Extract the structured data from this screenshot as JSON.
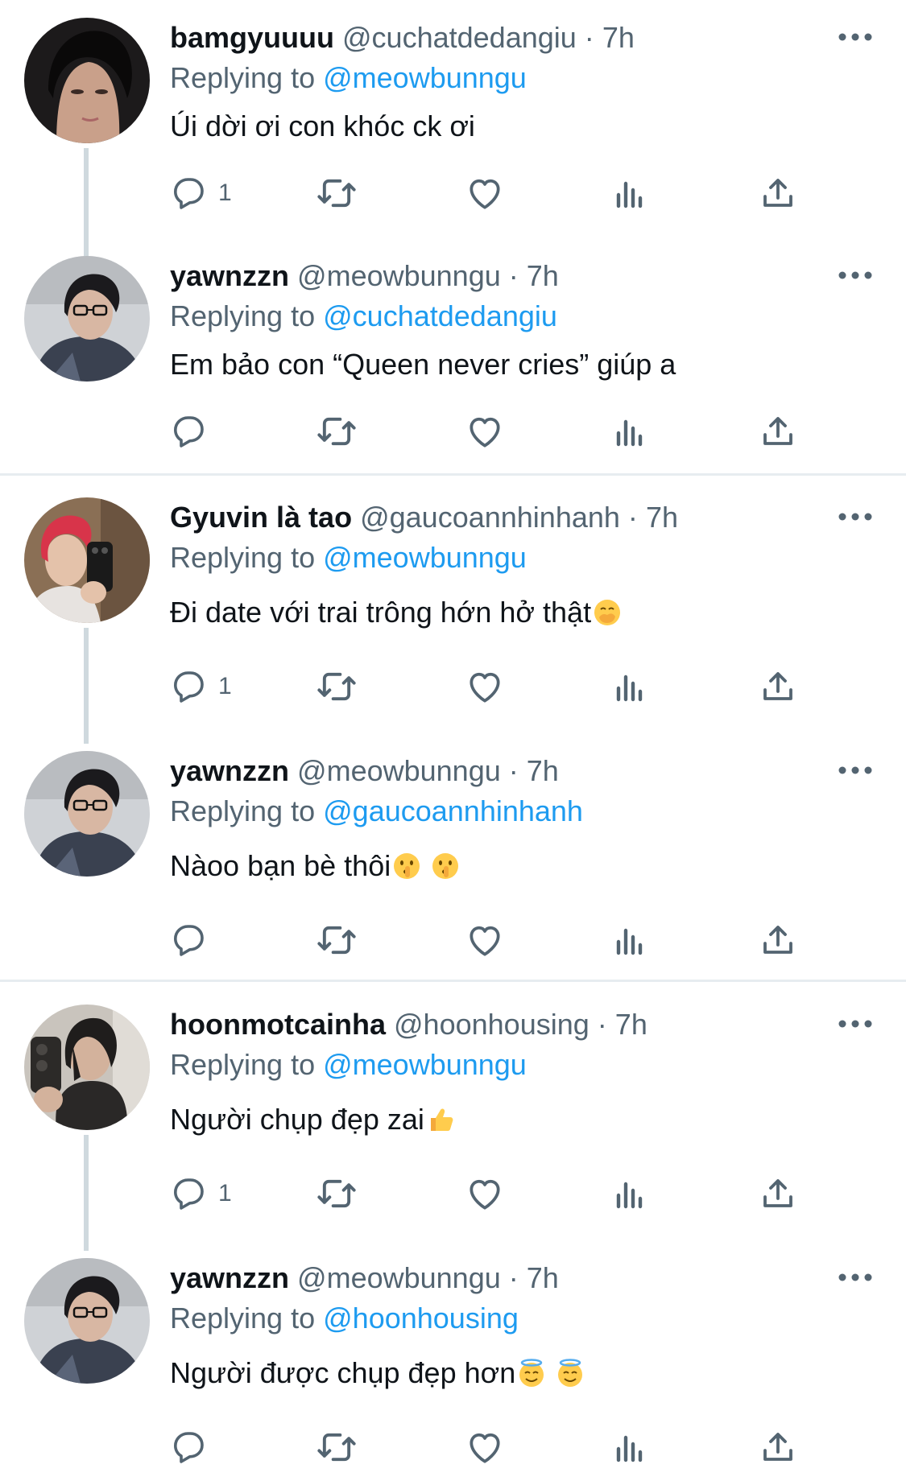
{
  "colors": {
    "accent": "#1d9bf0",
    "secondary_text": "#536471",
    "primary_text": "#0f1419",
    "divider": "#e7ecf0",
    "thread_line": "#cfd9de"
  },
  "icons": [
    "reply-icon",
    "retweet-icon",
    "like-icon",
    "views-icon",
    "share-icon",
    "more-icon"
  ],
  "tweets": [
    {
      "name": "bamgyuuuu",
      "handle": "@cuchatdedangiu",
      "time": "7h",
      "replying_label": "Replying to",
      "replying_to": "@meowbunngu",
      "text": "Úi dời ơi con khóc ck ơi",
      "reply_count": "1"
    },
    {
      "name": "yawnzzn",
      "handle": "@meowbunngu",
      "time": "7h",
      "replying_label": "Replying to",
      "replying_to": "@cuchatdedangiu",
      "text": "Em bảo con “Queen never cries” giúp a",
      "reply_count": ""
    },
    {
      "name": "Gyuvin là tao",
      "handle": "@gaucoannhinhanh",
      "time": "7h",
      "replying_label": "Replying to",
      "replying_to": "@meowbunngu",
      "text": "Đi date với trai trông hớn hở thật",
      "reply_count": "1"
    },
    {
      "name": "yawnzzn",
      "handle": "@meowbunngu",
      "time": "7h",
      "replying_label": "Replying to",
      "replying_to": "@gaucoannhinhanh",
      "text": "Nàoo bạn bè thôi",
      "reply_count": ""
    },
    {
      "name": "hoonmotcainha",
      "handle": "@hoonhousing",
      "time": "7h",
      "replying_label": "Replying to",
      "replying_to": "@meowbunngu",
      "text": "Người chụp đẹp zai",
      "reply_count": "1"
    },
    {
      "name": "yawnzzn",
      "handle": "@meowbunngu",
      "time": "7h",
      "replying_label": "Replying to",
      "replying_to": "@hoonhousing",
      "text": "Người được chụp đẹp hơn",
      "reply_count": ""
    }
  ]
}
